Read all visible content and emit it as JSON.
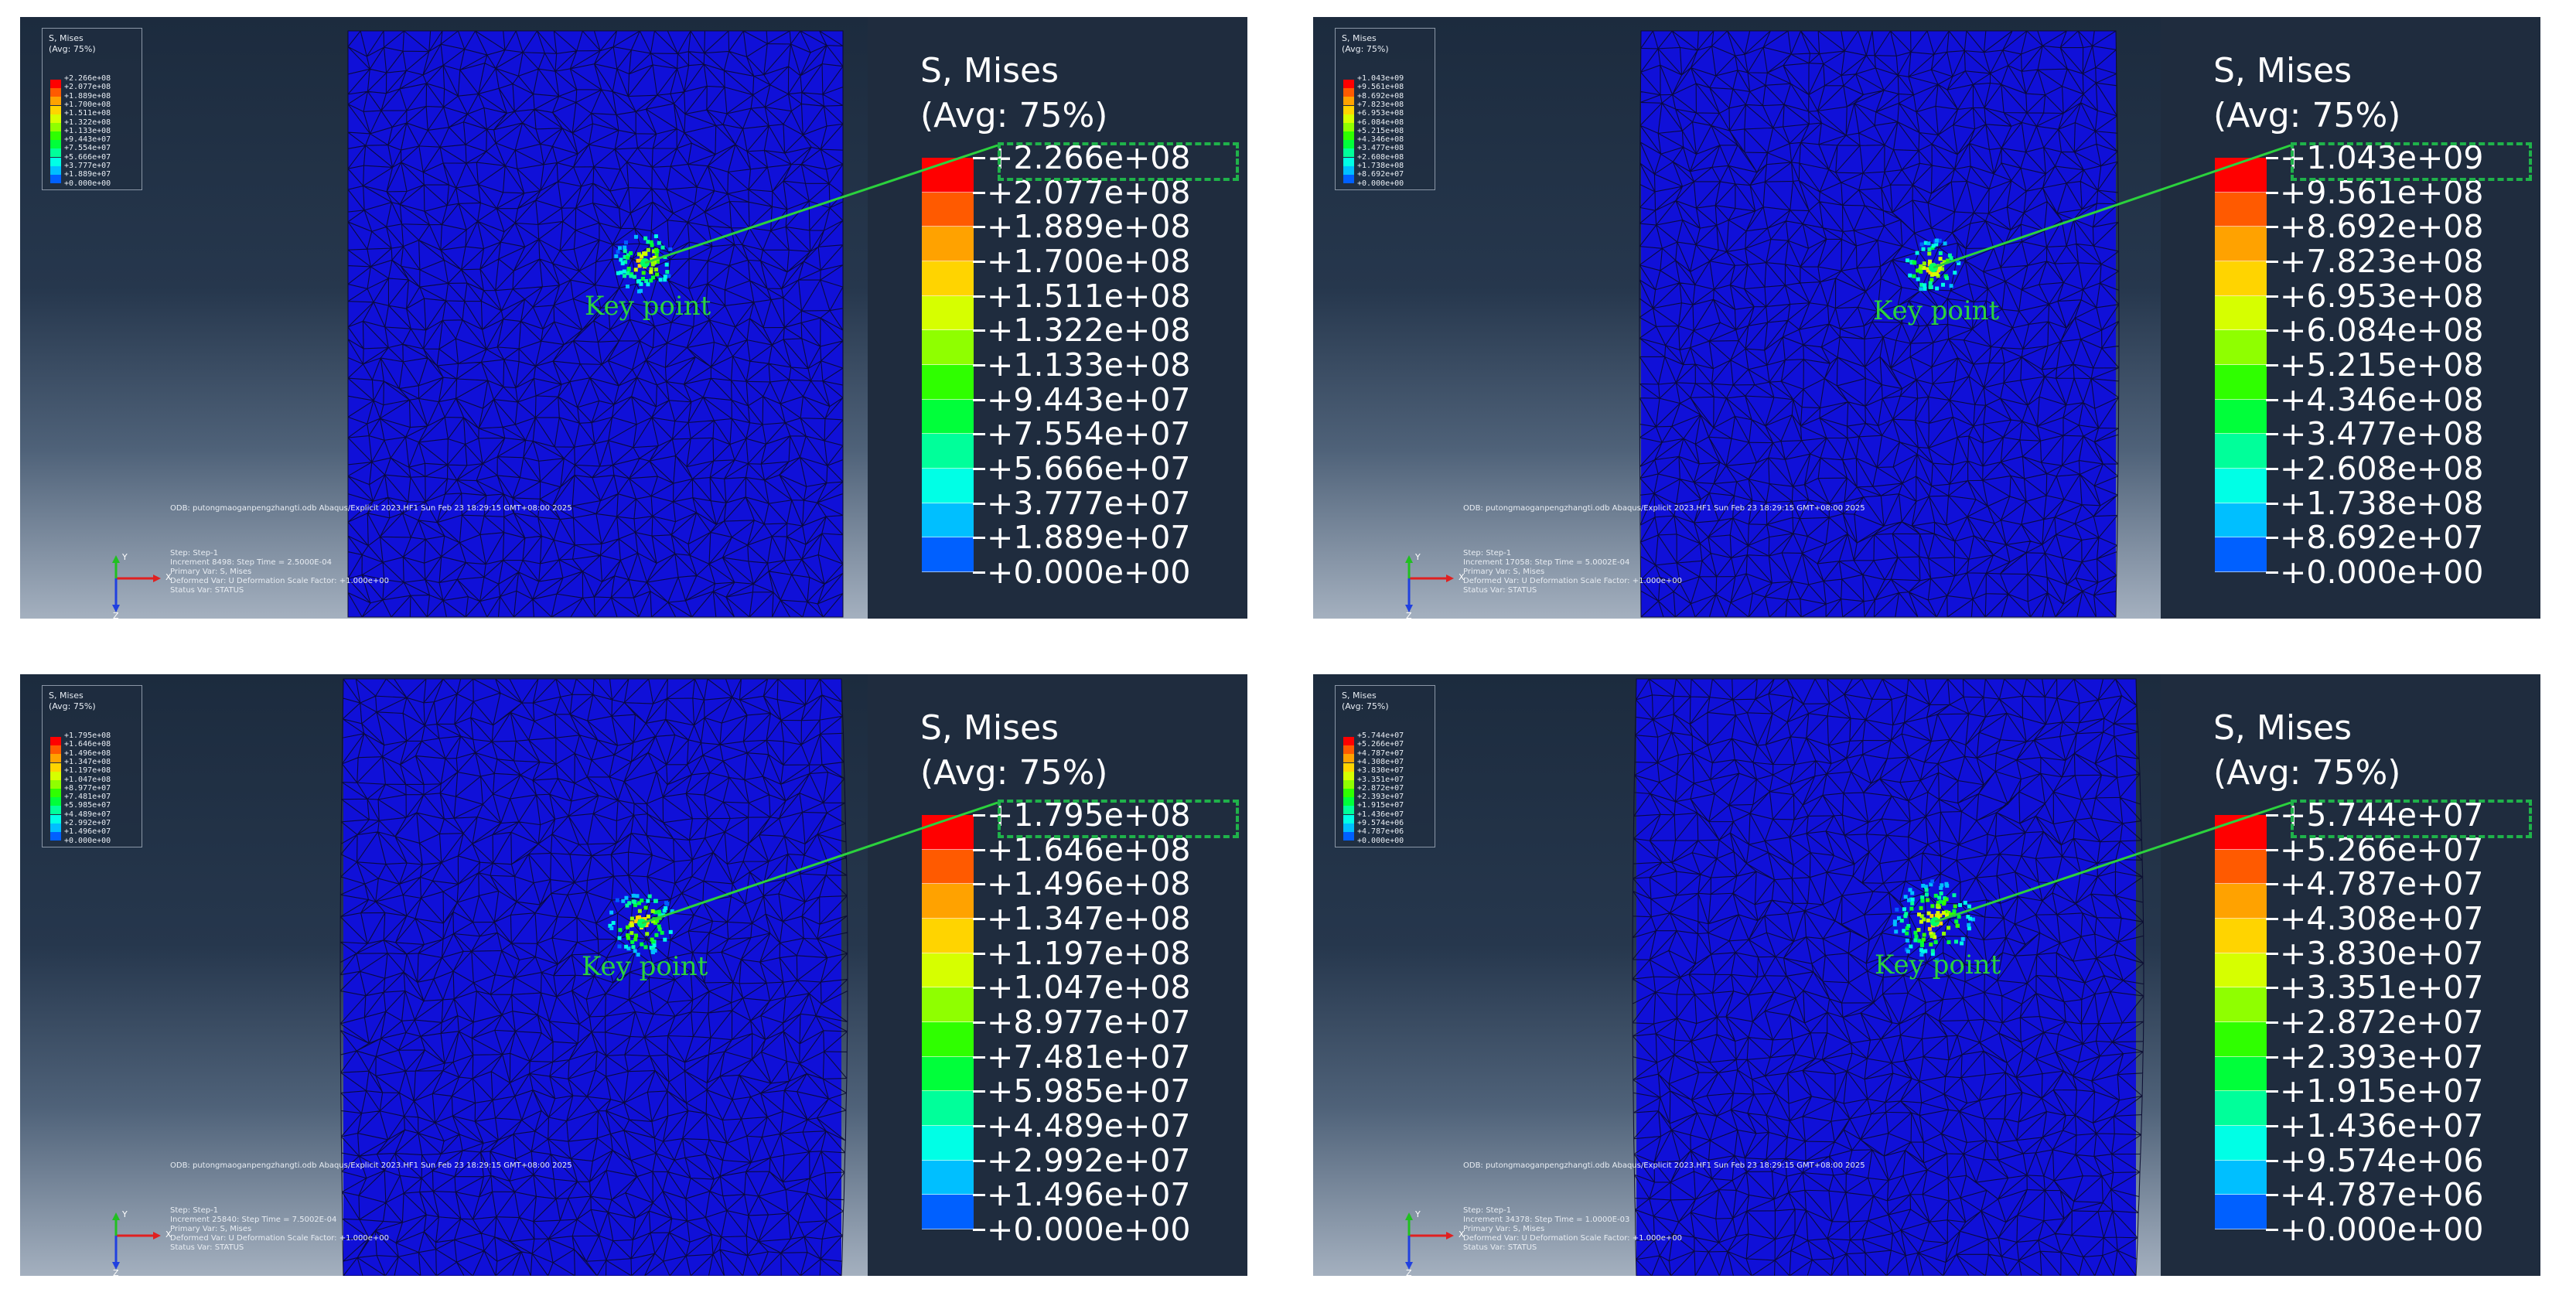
{
  "panels": [
    {
      "small_legend_title": [
        "S, Mises",
        "(Avg: 75%)"
      ],
      "legend_title": "S, Mises",
      "legend_avg": "(Avg: 75%)",
      "legend_values": [
        "+2.266e+08",
        "+2.077e+08",
        "+1.889e+08",
        "+1.700e+08",
        "+1.511e+08",
        "+1.322e+08",
        "+1.133e+08",
        "+9.443e+07",
        "+7.554e+07",
        "+5.666e+07",
        "+3.777e+07",
        "+1.889e+07",
        "+0.000e+00"
      ],
      "odb_line": "ODB: putongmaoganpengzhangti.odb    Abaqus/Explicit 2023.HF1    Sun Feb 23 18:29:15 GMT+08:00 2025",
      "step_line": "Step: Step-1",
      "increment_line": "Increment     8498: Step Time =    2.5000E-04",
      "primary_var_line": "Primary Var: S, Mises",
      "deformed_var_line": "Deformed Var: U   Deformation Scale Factor: +1.000e+00",
      "status_var_line": "Status Var: STATUS",
      "key_point_label": "Key point",
      "hotspot_level": 0.55
    },
    {
      "small_legend_title": [
        "S, Mises",
        "(Avg: 75%)"
      ],
      "legend_title": "S, Mises",
      "legend_avg": "(Avg: 75%)",
      "legend_values": [
        "+1.043e+09",
        "+9.561e+08",
        "+8.692e+08",
        "+7.823e+08",
        "+6.953e+08",
        "+6.084e+08",
        "+5.215e+08",
        "+4.346e+08",
        "+3.477e+08",
        "+2.608e+08",
        "+1.738e+08",
        "+8.692e+07",
        "+0.000e+00"
      ],
      "odb_line": "ODB: putongmaoganpengzhangti.odb    Abaqus/Explicit 2023.HF1    Sun Feb 23 18:29:15 GMT+08:00 2025",
      "step_line": "Step: Step-1",
      "increment_line": "Increment    17058: Step Time =    5.0002E-04",
      "primary_var_line": "Primary Var: S, Mises",
      "deformed_var_line": "Deformed Var: U   Deformation Scale Factor: +1.000e+00",
      "status_var_line": "Status Var: STATUS",
      "key_point_label": "Key point",
      "hotspot_level": 0.45
    },
    {
      "small_legend_title": [
        "S, Mises",
        "(Avg: 75%)"
      ],
      "legend_title": "S, Mises",
      "legend_avg": "(Avg: 75%)",
      "legend_values": [
        "+1.795e+08",
        "+1.646e+08",
        "+1.496e+08",
        "+1.347e+08",
        "+1.197e+08",
        "+1.047e+08",
        "+8.977e+07",
        "+7.481e+07",
        "+5.985e+07",
        "+4.489e+07",
        "+2.992e+07",
        "+1.496e+07",
        "+0.000e+00"
      ],
      "odb_line": "ODB: putongmaoganpengzhangti.odb    Abaqus/Explicit 2023.HF1    Sun Feb 23 18:29:15 GMT+08:00 2025",
      "step_line": "Step: Step-1",
      "increment_line": "Increment    25840: Step Time =    7.5002E-04",
      "primary_var_line": "Primary Var: S, Mises",
      "deformed_var_line": "Deformed Var: U   Deformation Scale Factor: +1.000e+00",
      "status_var_line": "Status Var: STATUS",
      "key_point_label": "Key point",
      "hotspot_level": 0.7
    },
    {
      "small_legend_title": [
        "S, Mises",
        "(Avg: 75%)"
      ],
      "legend_title": "S, Mises",
      "legend_avg": "(Avg: 75%)",
      "legend_values": [
        "+5.744e+07",
        "+5.266e+07",
        "+4.787e+07",
        "+4.308e+07",
        "+3.830e+07",
        "+3.351e+07",
        "+2.872e+07",
        "+2.393e+07",
        "+1.915e+07",
        "+1.436e+07",
        "+9.574e+06",
        "+4.787e+06",
        "+0.000e+00"
      ],
      "odb_line": "ODB: putongmaoganpengzhangti.odb    Abaqus/Explicit 2023.HF1    Sun Feb 23 18:29:15 GMT+08:00 2025",
      "step_line": "Step: Step-1",
      "increment_line": "Increment    34378: Step Time =    1.0000E-03",
      "primary_var_line": "Primary Var: S, Mises",
      "deformed_var_line": "Deformed Var: U   Deformation Scale Factor: +1.000e+00",
      "status_var_line": "Status Var: STATUS",
      "key_point_label": "Key point",
      "hotspot_level": 1.0
    }
  ],
  "triad_labels": {
    "x": "X",
    "y": "Y",
    "z": "Z"
  },
  "contour_colors": [
    "#ff0000",
    "#ff5a00",
    "#ffa200",
    "#ffd400",
    "#d6ff00",
    "#8fff00",
    "#2fff00",
    "#00ff3a",
    "#00ff9a",
    "#00ffe6",
    "#00bfff",
    "#0060ff",
    "#0000ff"
  ],
  "colors": {
    "mesh_fill": "#1010d8",
    "mesh_line": "#0a0a30",
    "accent_green": "#2bd23d",
    "legend_bg": "#1f2c3e"
  }
}
